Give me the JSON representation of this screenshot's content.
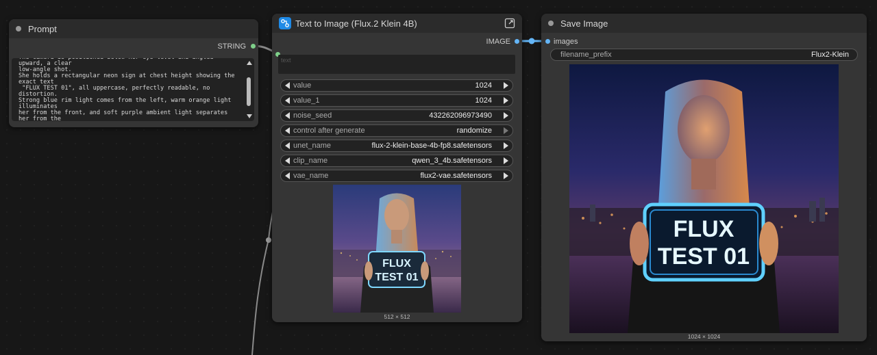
{
  "prompt_node": {
    "title": "Prompt",
    "output_label": "STRING",
    "text": "The camera is positioned below her eye level and angled upward, a clear\nlow-angle shot.\nShe holds a rectangular neon sign at chest height showing the exact text\n \"FLUX TEST 01\", all uppercase, perfectly readable, no distortion.\nStrong blue rim light comes from the left, warm orange light illuminates\nher from the front, and soft purple ambient light separates her from the\nbackground.\nThe dominant colors are deep blue, cyan, and vivid orange with strong\ncontrast.\nUltra-realistic photography, cinematic lighting, sharp focus, shallow\ndepth of field."
  },
  "t2i_node": {
    "title": "Text to Image (Flux.2 Klein 4B)",
    "output_label": "IMAGE",
    "text_placeholder": "text",
    "widgets": [
      {
        "name": "value",
        "value": "1024",
        "active": true
      },
      {
        "name": "value_1",
        "value": "1024",
        "active": true
      },
      {
        "name": "noise_seed",
        "value": "432262096973490",
        "active": true
      },
      {
        "name": "control after generate",
        "value": "randomize",
        "active": false
      },
      {
        "name": "unet_name",
        "value": "flux-2-klein-base-4b-fp8.safetensors",
        "active": true
      },
      {
        "name": "clip_name",
        "value": "qwen_3_4b.safetensors",
        "active": true
      },
      {
        "name": "vae_name",
        "value": "flux2-vae.safetensors",
        "active": true
      }
    ],
    "preview_sign_line1": "FLUX",
    "preview_sign_line2": "TEST 01",
    "preview_size": "512 × 512"
  },
  "save_node": {
    "title": "Save Image",
    "input_label": "images",
    "filename_prefix_label": "filename_prefix",
    "filename_prefix_value": "Flux2-Klein",
    "image_sign_line1": "FLUX",
    "image_sign_line2": "TEST 01",
    "image_size": "1024 × 1024"
  },
  "colors": {
    "canvas": "#171717",
    "node_body": "#353535",
    "node_header": "#2b2b2b",
    "string_slot": "#7fd08a",
    "image_slot": "#64b5f6",
    "neon": "#5fd0ff"
  }
}
